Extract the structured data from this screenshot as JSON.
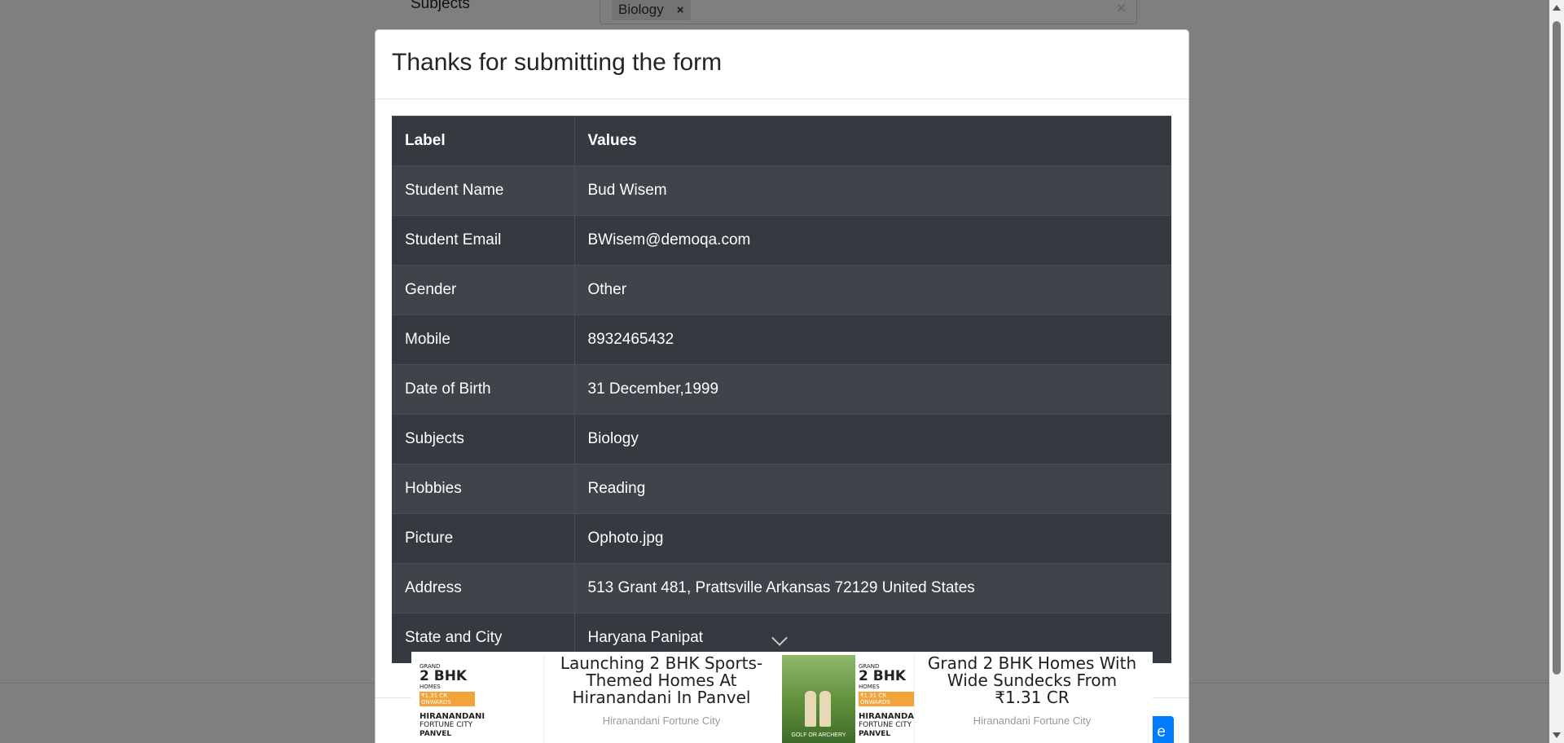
{
  "background": {
    "subjects_label": "Subjects",
    "subjects_chip": "Biology",
    "chip_remove": "×",
    "clear_all": "×"
  },
  "modal": {
    "title": "Thanks for submitting the form",
    "table": {
      "headers": [
        "Label",
        "Values"
      ],
      "rows": [
        {
          "label": "Student Name",
          "value": "Bud Wisem"
        },
        {
          "label": "Student Email",
          "value": "BWisem@demoqa.com"
        },
        {
          "label": "Gender",
          "value": "Other"
        },
        {
          "label": "Mobile",
          "value": "8932465432"
        },
        {
          "label": "Date of Birth",
          "value": "31 December,1999"
        },
        {
          "label": "Subjects",
          "value": "Biology"
        },
        {
          "label": "Hobbies",
          "value": "Reading"
        },
        {
          "label": "Picture",
          "value": "Ophoto.jpg"
        },
        {
          "label": "Address",
          "value": "513 Grant 481, Prattsville Arkansas 72129 United States"
        },
        {
          "label": "State and City",
          "value": "Haryana Panipat"
        }
      ]
    },
    "close_label": "e"
  },
  "ads": [
    {
      "headline": "Launching 2 BHK Sports-Themed Homes At Hiranandani In Panvel",
      "source": "Hiranandani Fortune City",
      "thumb": {
        "grand": "GRAND",
        "bhk": "2 BHK",
        "homes": "HOMES",
        "price": "₹1.31 CR ONWARDS",
        "brand": "HIRANANDANI",
        "fortune": "FORTUNE CITY",
        "place": "PANVEL"
      }
    },
    {
      "headline": "Grand 2 BHK Homes With Wide Sundecks From ₹1.31 CR",
      "source": "Hiranandani Fortune City",
      "thumb": {
        "caption": "GOLF OR ARCHERY",
        "grand": "GRAND",
        "bhk": "2 BHK",
        "homes": "HOMES",
        "price": "₹1.31 CR ONWARDS",
        "brand": "HIRANANDANI",
        "fortune": "FORTUNE CITY",
        "place": "PANVEL"
      }
    }
  ],
  "colors": {
    "table_dark": "#343a40",
    "table_stripe": "#3e444a",
    "primary": "#007bff",
    "backdrop": "rgba(0,0,0,0.5)"
  }
}
